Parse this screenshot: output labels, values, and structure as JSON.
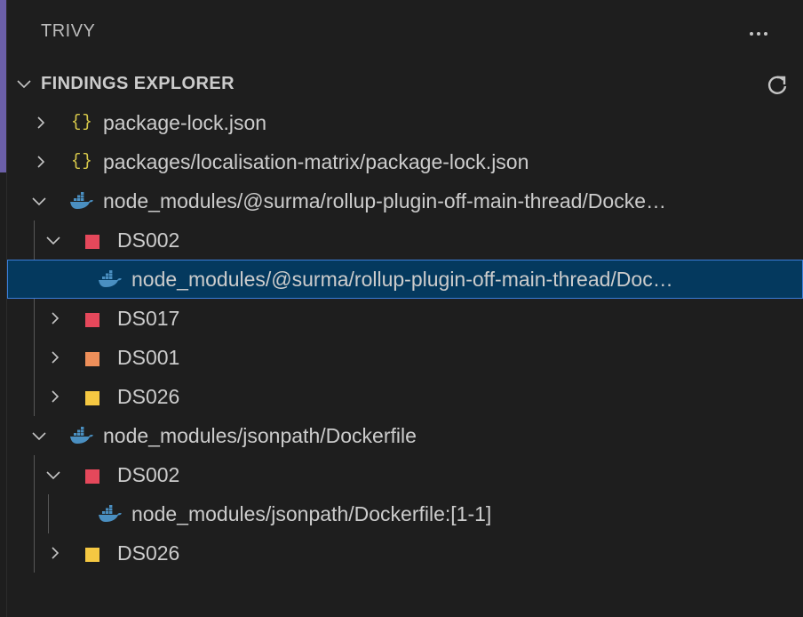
{
  "panel": {
    "title": "TRIVY",
    "more_icon": "ellipsis-icon"
  },
  "section": {
    "title": "FINDINGS EXPLORER",
    "refresh_icon": "refresh-icon"
  },
  "colors": {
    "critical": "#e5485b",
    "high": "#ee8f5a",
    "medium": "#f5c842",
    "json_icon": "#d7c84a",
    "docker_icon": "#4a8fc1",
    "selection_bg": "#04395e",
    "selection_border": "#3b7dd8"
  },
  "tree": [
    {
      "label": "package-lock.json",
      "icon": "json-icon",
      "expanded": false
    },
    {
      "label": "packages/localisation-matrix/package-lock.json",
      "icon": "json-icon",
      "expanded": false
    },
    {
      "label": "node_modules/@surma/rollup-plugin-off-main-thread/Docke…",
      "icon": "docker-icon",
      "expanded": true,
      "children": [
        {
          "label": "DS002",
          "severity": "critical",
          "expanded": true,
          "children": [
            {
              "label": "node_modules/@surma/rollup-plugin-off-main-thread/Doc…",
              "icon": "docker-icon",
              "selected": true
            }
          ]
        },
        {
          "label": "DS017",
          "severity": "critical",
          "expanded": false
        },
        {
          "label": "DS001",
          "severity": "high",
          "expanded": false
        },
        {
          "label": "DS026",
          "severity": "medium",
          "expanded": false
        }
      ]
    },
    {
      "label": "node_modules/jsonpath/Dockerfile",
      "icon": "docker-icon",
      "expanded": true,
      "children": [
        {
          "label": "DS002",
          "severity": "critical",
          "expanded": true,
          "children": [
            {
              "label": "node_modules/jsonpath/Dockerfile:[1-1]",
              "icon": "docker-icon"
            }
          ]
        },
        {
          "label": "DS026",
          "severity": "medium",
          "expanded": false
        }
      ]
    }
  ]
}
